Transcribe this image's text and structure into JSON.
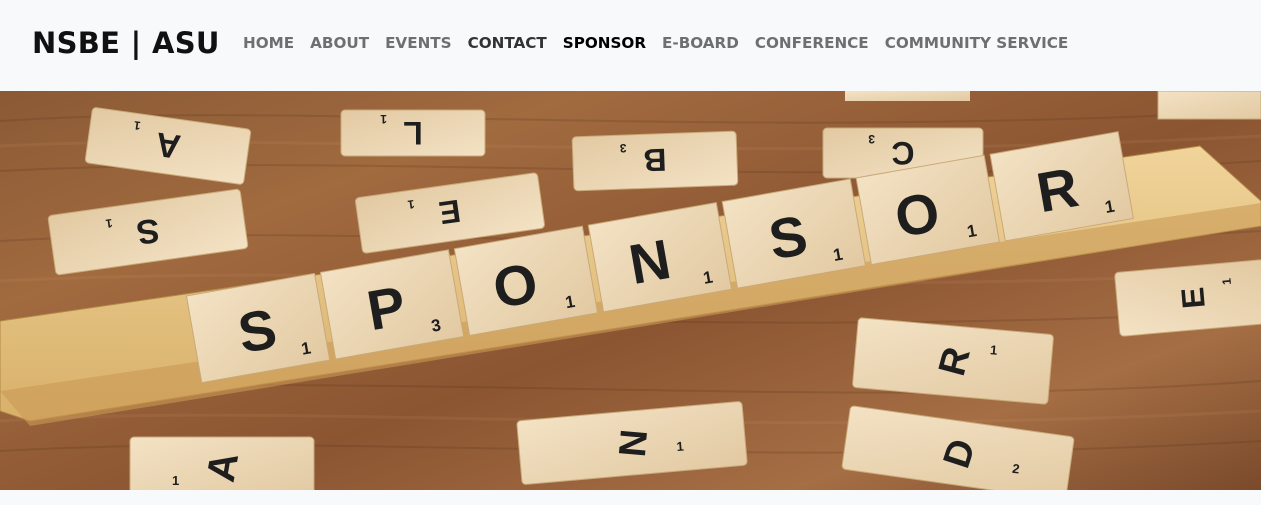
{
  "brand": {
    "title": "NSBE | ASU"
  },
  "nav": {
    "items": [
      {
        "label": "HOME"
      },
      {
        "label": "ABOUT"
      },
      {
        "label": "EVENTS"
      },
      {
        "label": "CONTACT"
      },
      {
        "label": "SPONSOR"
      },
      {
        "label": "E-BOARD"
      },
      {
        "label": "CONFERENCE"
      },
      {
        "label": "COMMUNITY SERVICE"
      }
    ]
  },
  "hero": {
    "word_tiles": [
      {
        "letter": "S",
        "score": "1"
      },
      {
        "letter": "P",
        "score": "3"
      },
      {
        "letter": "O",
        "score": "1"
      },
      {
        "letter": "N",
        "score": "1"
      },
      {
        "letter": "S",
        "score": "1"
      },
      {
        "letter": "O",
        "score": "1"
      },
      {
        "letter": "R",
        "score": "1"
      }
    ],
    "scattered_tiles": [
      {
        "letter": "A",
        "score": "1"
      },
      {
        "letter": "L",
        "score": "1"
      },
      {
        "letter": "B",
        "score": "3"
      },
      {
        "letter": "C",
        "score": "3"
      },
      {
        "letter": "S",
        "score": "1"
      },
      {
        "letter": "E",
        "score": "1"
      },
      {
        "letter": "E",
        "score": "1"
      },
      {
        "letter": "R",
        "score": "1"
      },
      {
        "letter": "A",
        "score": "1"
      },
      {
        "letter": "N",
        "score": "1"
      },
      {
        "letter": "D",
        "score": "2"
      }
    ]
  }
}
